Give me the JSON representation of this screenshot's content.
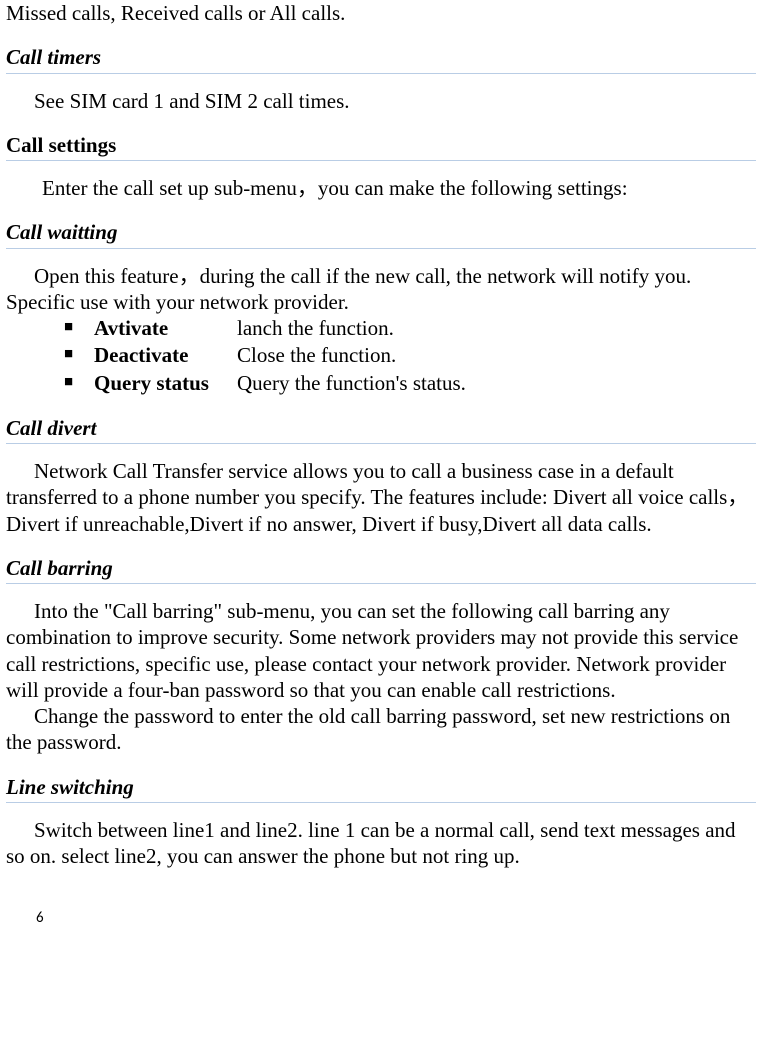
{
  "intro_line": "Missed calls, Received calls or All calls.",
  "call_timers": {
    "heading": "Call timers",
    "body": "See SIM card 1 and SIM 2 call times."
  },
  "call_settings": {
    "heading": "Call settings",
    "body": "Enter the call set up sub-menu，you can make the following settings:"
  },
  "call_waitting": {
    "heading": "Call waitting",
    "body": "Open this feature，during the call if the new call, the network will notify you. Specific use with your network provider.",
    "items": [
      {
        "label": "Avtivate",
        "desc": "lanch the function."
      },
      {
        "label": "Deactivate",
        "desc": "Close the function."
      },
      {
        "label": "Query status",
        "desc": "Query the function's status."
      }
    ]
  },
  "call_divert": {
    "heading": "Call divert",
    "body": "Network Call Transfer service allows you to call a business case in a default transferred to a phone number you specify. The features include: Divert all voice calls，Divert if unreachable,Divert if no answer, Divert if busy,Divert all data calls."
  },
  "call_barring": {
    "heading": "Call barring",
    "body1": "Into the \"Call barring\" sub-menu, you can set the following call barring any combination to improve security. Some network providers may not provide this service call restrictions, specific use, please contact your network provider. Network provider will provide a four-ban password so that you can enable call restrictions.",
    "body2": "Change the password to enter the old call barring password, set new restrictions on the password."
  },
  "line_switching": {
    "heading": "Line switching",
    "body": "Switch between line1 and line2. line 1 can be a normal call, send text messages and so on. select line2, you can answer the phone but not ring up."
  },
  "page_number": "6"
}
